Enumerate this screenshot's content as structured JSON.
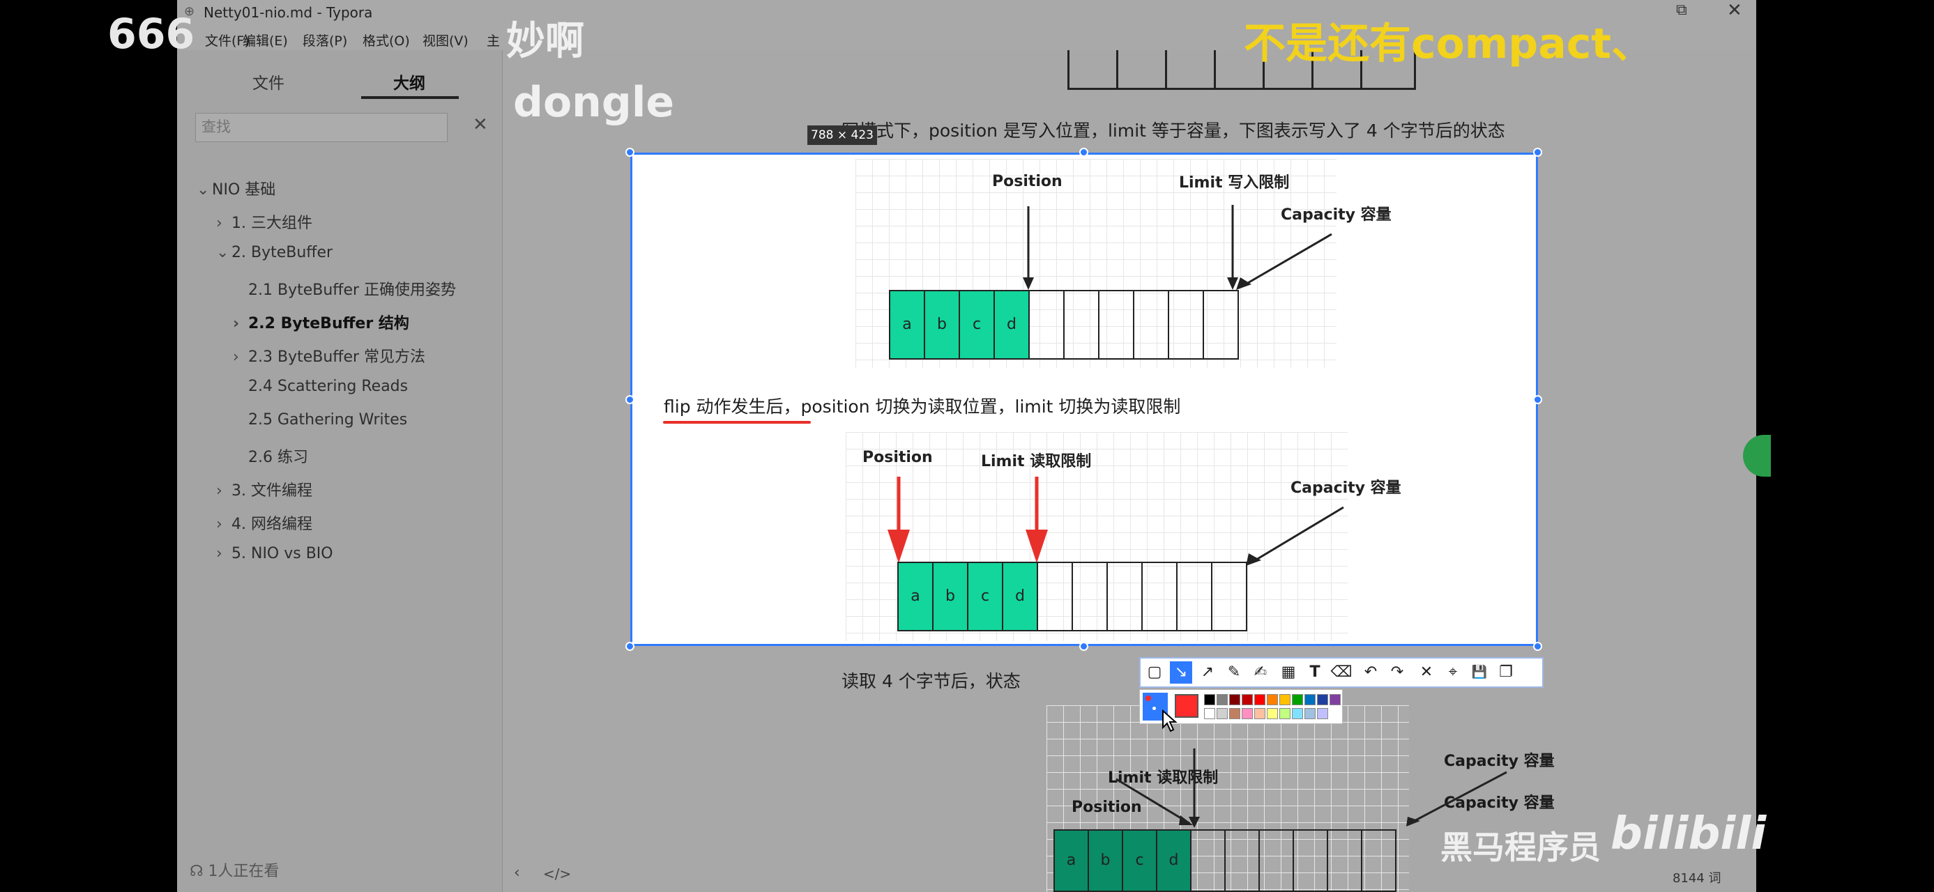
{
  "window": {
    "title": "Netty01-nio.md - Typora",
    "controls": {
      "restore_icon": "restore-icon",
      "close_icon": "close-icon"
    }
  },
  "menu": [
    "文件(F)",
    "编辑(E)",
    "段落(P)",
    "格式(O)",
    "视图(V)",
    "主"
  ],
  "sidebar": {
    "tabs": [
      "文件",
      "大纲"
    ],
    "active_tab": "大纲",
    "search": {
      "placeholder": "查找",
      "value": ""
    },
    "outline": [
      {
        "label": "NIO 基础"
      },
      {
        "label": "1. 三大组件"
      },
      {
        "label": "2. ByteBuffer"
      },
      {
        "label": "2.1 ByteBuffer 正确使用姿势"
      },
      {
        "label": "2.2 ByteBuffer 结构"
      },
      {
        "label": "2.3 ByteBuffer 常见方法"
      },
      {
        "label": "2.4 Scattering Reads"
      },
      {
        "label": "2.5 Gathering Writes"
      },
      {
        "label": "2.6 练习"
      },
      {
        "label": "3. 文件编程"
      },
      {
        "label": "4. 网络编程"
      },
      {
        "label": "5. NIO vs BIO"
      }
    ],
    "viewers": "1人正在看"
  },
  "document": {
    "para_write": "写模式下，position 是写入位置，limit 等于容量，下图表示写入了 4 个字节后的状态",
    "para_flip": "flip 动作发生后，position 切换为读取位置，limit 切换为读取限制",
    "para_read": "读取 4 个字节后，状态",
    "word_count": "8144 词",
    "fig1": {
      "position": "Position",
      "limit": "Limit 写入限制",
      "capacity": "Capacity 容量",
      "cells": [
        "a",
        "b",
        "c",
        "d"
      ]
    },
    "fig2": {
      "position": "Position",
      "limit": "Limit 读取限制",
      "capacity": "Capacity 容量",
      "cells": [
        "a",
        "b",
        "c",
        "d"
      ]
    },
    "fig3": {
      "position": "Position",
      "limit": "Limit 读取限制",
      "capacity": "Capacity 容量",
      "cells": [
        "a",
        "b",
        "c",
        "d"
      ]
    }
  },
  "screenshot_tool": {
    "size_label": "788 × 423",
    "tools": [
      "rect-icon",
      "pen-icon",
      "arrow-icon",
      "pencil-icon",
      "marker-icon",
      "mosaic-icon",
      "text-icon",
      "eraser-icon",
      "undo-icon",
      "redo-icon",
      "cancel-icon",
      "pin-icon",
      "save-icon",
      "copy-icon"
    ],
    "tool_glyphs": [
      "▢",
      "↘",
      "↗",
      "✎",
      "✍",
      "▦",
      "T",
      "⌫",
      "↶",
      "↷",
      "✕",
      "⌖",
      "💾",
      "❐"
    ],
    "active_color": "#ff2a2a",
    "palette": [
      "#000000",
      "#808080",
      "#800000",
      "#c00000",
      "#ff0000",
      "#ff8000",
      "#ffc000",
      "#00a000",
      "#0070c0",
      "#2040a0",
      "#8040a0",
      "#ffffff",
      "#d0d0d0",
      "#c08060",
      "#ff90c0",
      "#ffc0a0",
      "#ffff80",
      "#c0ff80",
      "#80e0ff",
      "#a0c0e0",
      "#c0c0ff"
    ]
  },
  "danmaku": [
    {
      "text": "666"
    },
    {
      "text": "妙啊"
    },
    {
      "text": "dongle"
    },
    {
      "text": "不是还有compact、"
    }
  ],
  "watermark": {
    "brand": "黑马程序员",
    "logo": "bilibili"
  },
  "colors": {
    "selection": "#2f7bff",
    "buffer_fill": "#12d69c",
    "red_arrow": "#e8302a",
    "danmaku_yellow": "#f2d21b"
  }
}
